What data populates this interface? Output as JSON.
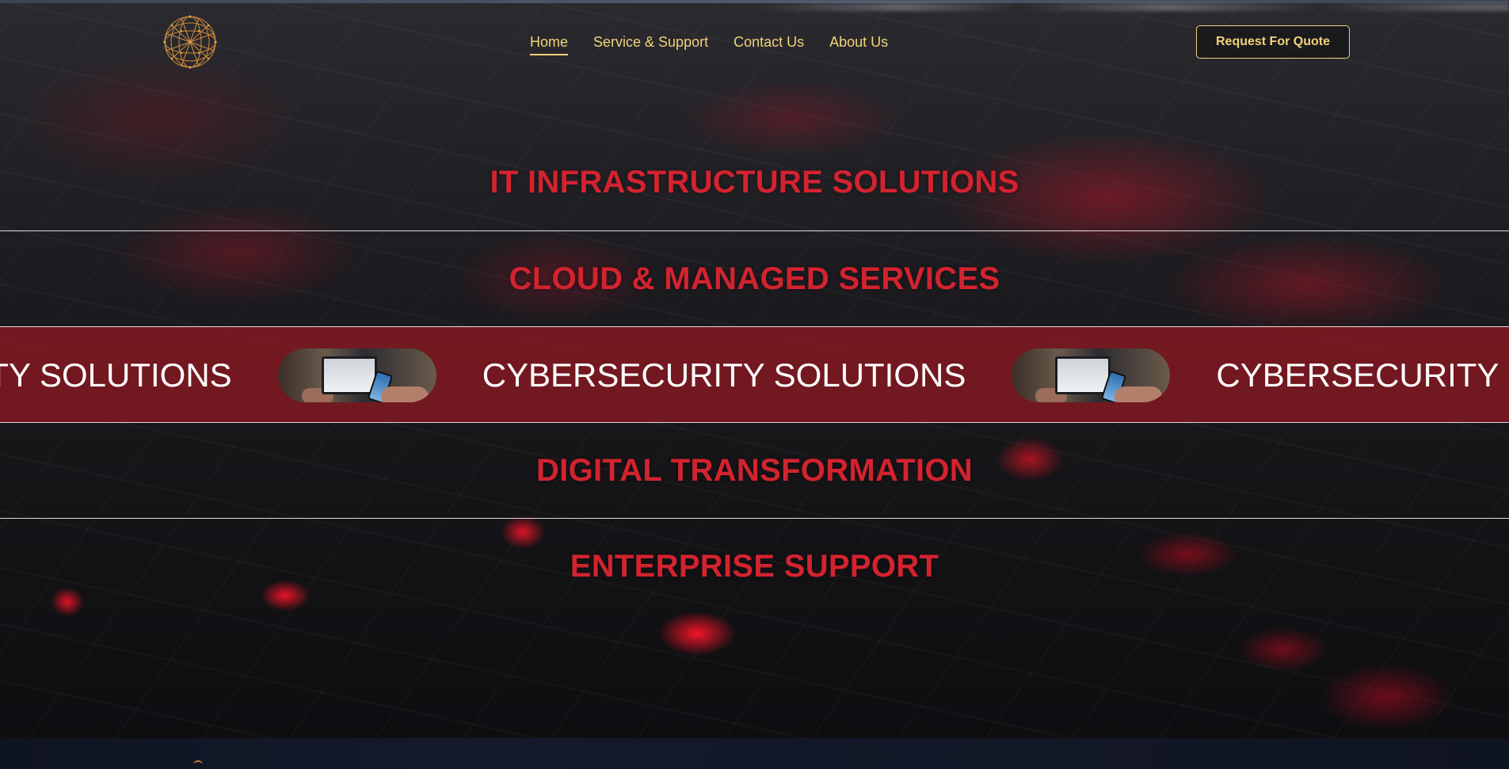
{
  "colors": {
    "accent_gold": "#f3d27a",
    "accent_red": "#d2232f",
    "active_row_bg": "#961923"
  },
  "header": {
    "logo_icon": "wireframe-globe-icon",
    "nav": [
      {
        "label": "Home",
        "active": true
      },
      {
        "label": "Service & Support",
        "active": false
      },
      {
        "label": "Contact Us",
        "active": false
      },
      {
        "label": "About Us",
        "active": false
      }
    ],
    "quote_button": "Request For Quote"
  },
  "services": {
    "rows": [
      {
        "label": "IT INFRASTRUCTURE SOLUTIONS"
      },
      {
        "label": "CLOUD & MANAGED SERVICES"
      },
      {
        "label": "CYBERSECURITY SOLUTIONS",
        "active": true,
        "marquee_image": "laptop-and-phone-photo"
      },
      {
        "label": "DIGITAL TRANSFORMATION"
      },
      {
        "label": "ENTERPRISE SUPPORT"
      }
    ],
    "marquee_text": "CYBERSECURITY SOLUTIONS"
  }
}
